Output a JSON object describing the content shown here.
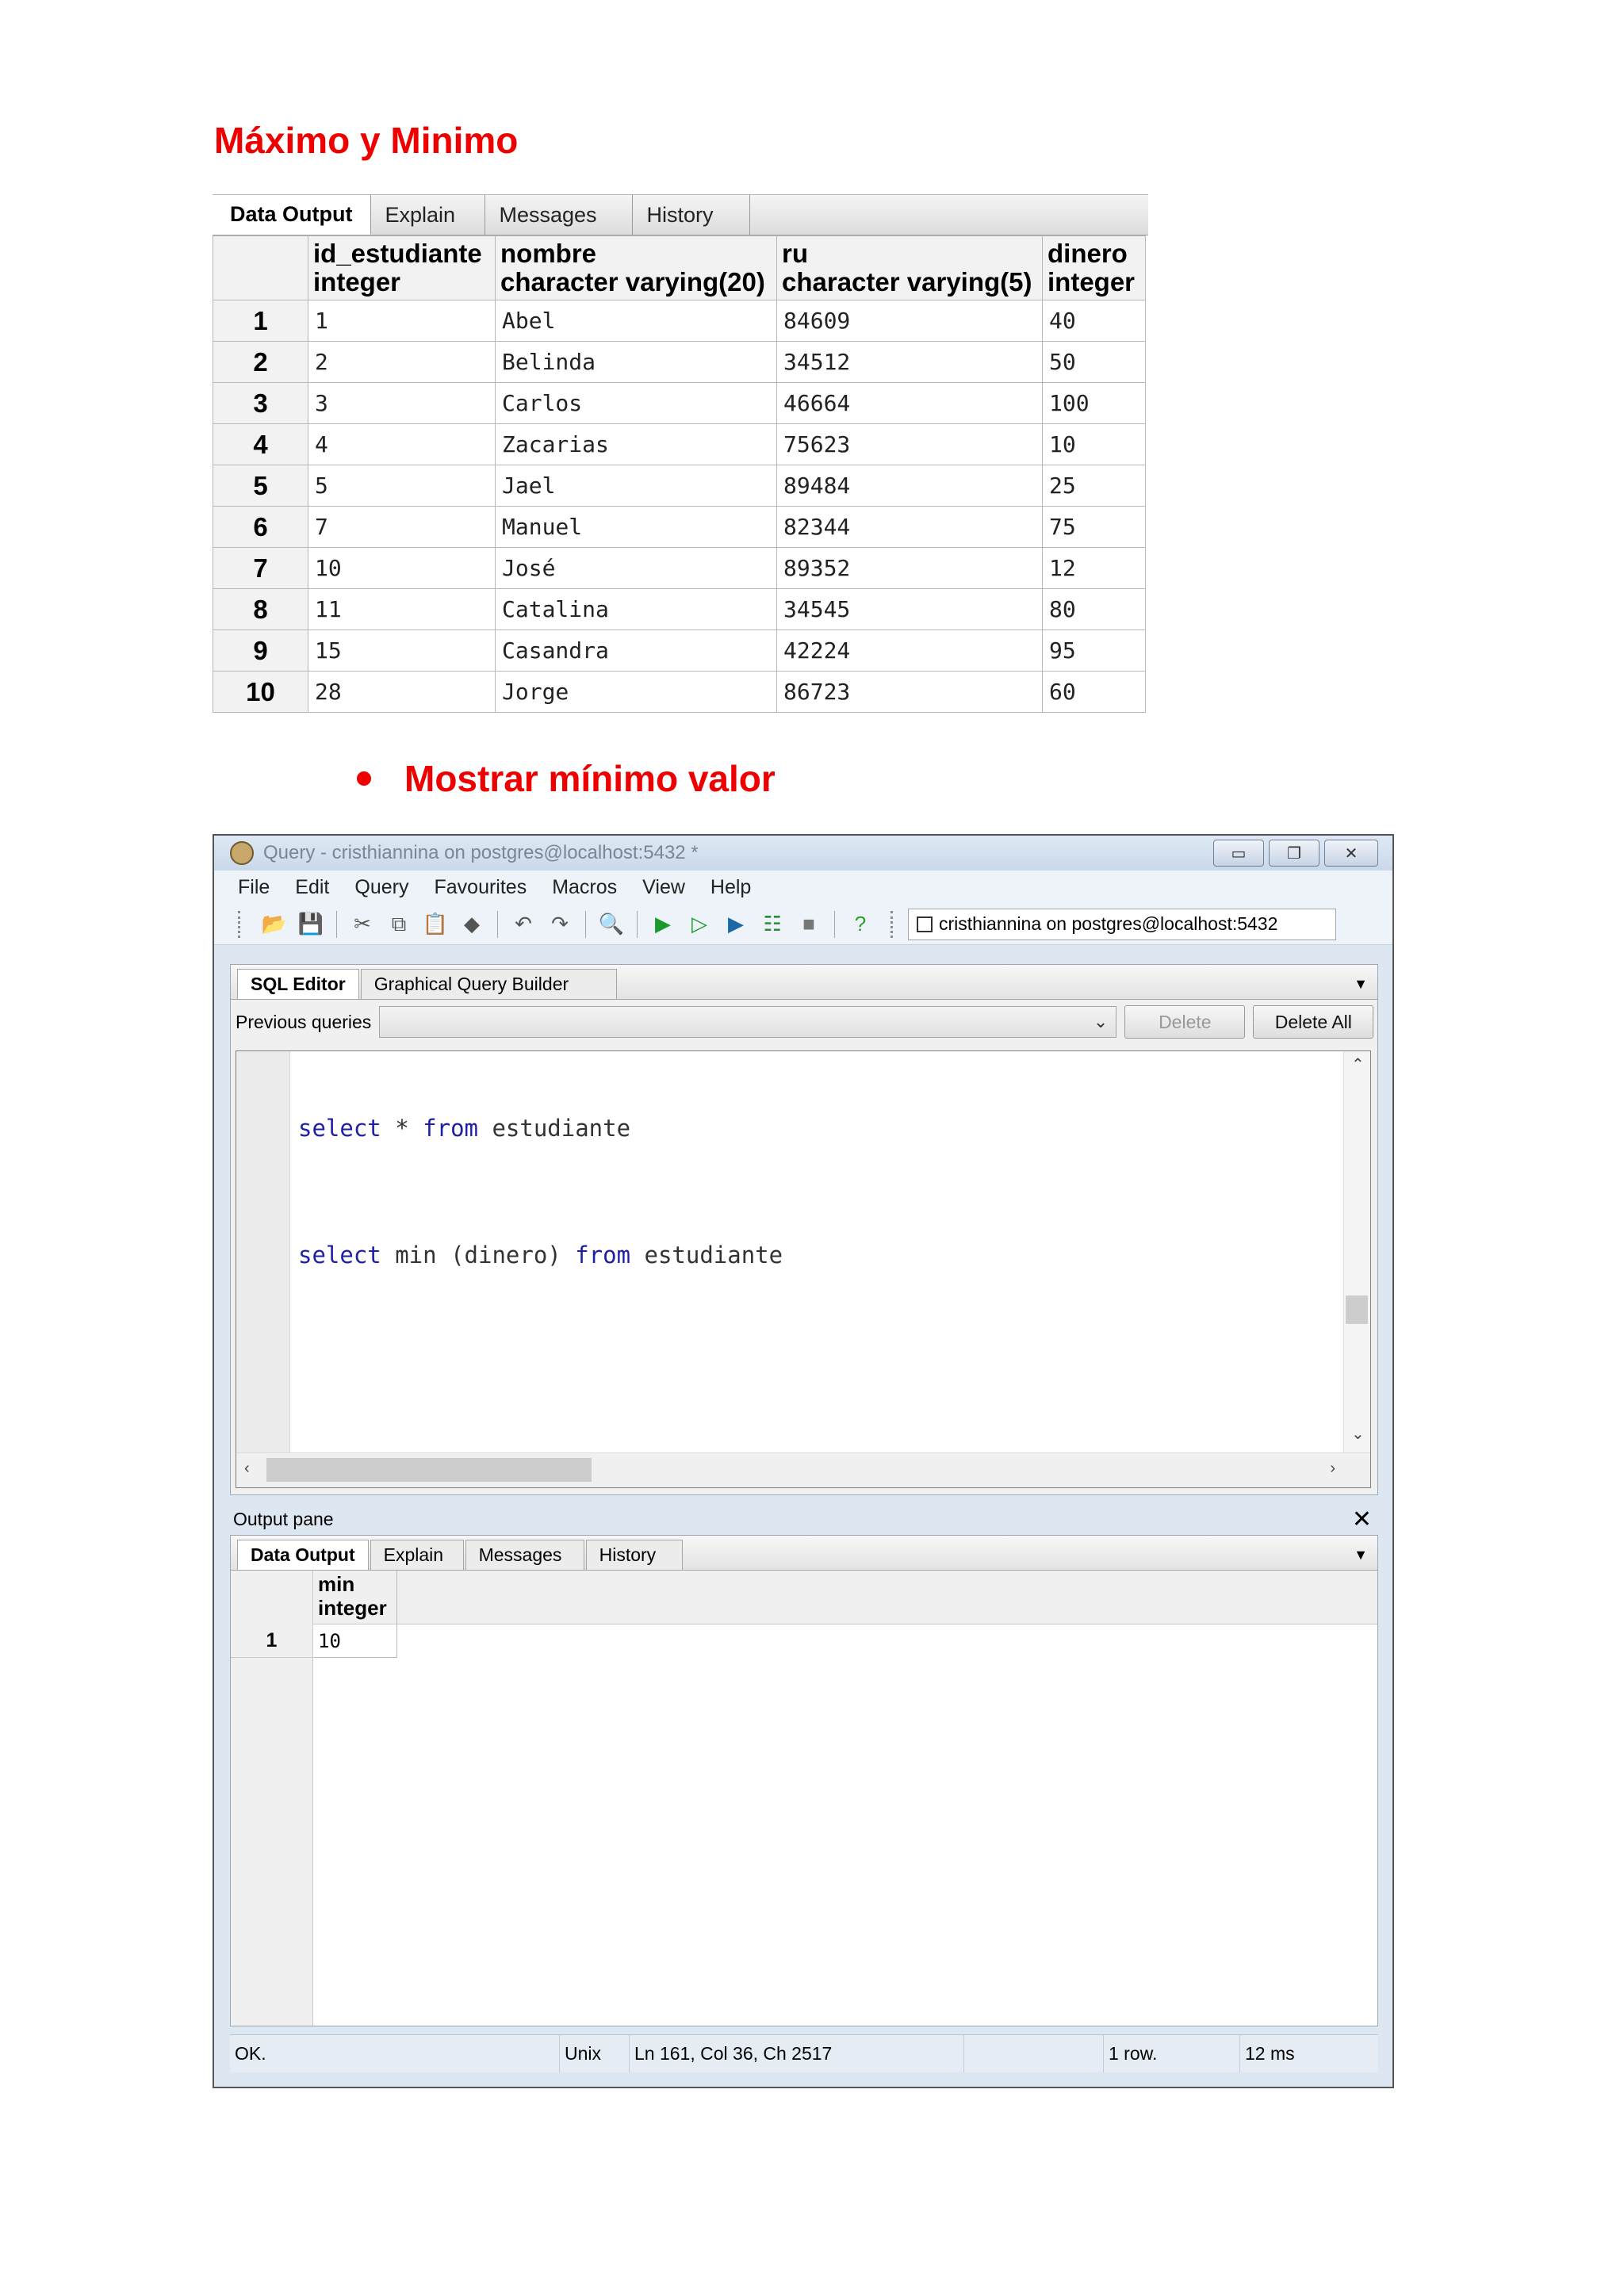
{
  "heading": "Máximo y Minimo",
  "bullet_text": "Mostrar mínimo valor",
  "grid1": {
    "tabs": [
      "Data Output",
      "Explain",
      "Messages",
      "History"
    ],
    "columns": [
      {
        "name": "id_estudiante",
        "type": "integer"
      },
      {
        "name": "nombre",
        "type": "character varying(20)"
      },
      {
        "name": "ru",
        "type": "character varying(5)"
      },
      {
        "name": "dinero",
        "type": "integer"
      }
    ],
    "rows": [
      [
        "1",
        "1",
        "Abel",
        "84609",
        "40"
      ],
      [
        "2",
        "2",
        "Belinda",
        "34512",
        "50"
      ],
      [
        "3",
        "3",
        "Carlos",
        "46664",
        "100"
      ],
      [
        "4",
        "4",
        "Zacarias",
        "75623",
        "10"
      ],
      [
        "5",
        "5",
        "Jael",
        "89484",
        "25"
      ],
      [
        "6",
        "7",
        "Manuel",
        "82344",
        "75"
      ],
      [
        "7",
        "10",
        "José",
        "89352",
        "12"
      ],
      [
        "8",
        "11",
        "Catalina",
        "34545",
        "80"
      ],
      [
        "9",
        "15",
        "Casandra",
        "42224",
        "95"
      ],
      [
        "10",
        "28",
        "Jorge",
        "86723",
        "60"
      ]
    ]
  },
  "window": {
    "title": "Query - cristhiannina on postgres@localhost:5432 *",
    "menu": [
      "File",
      "Edit",
      "Query",
      "Favourites",
      "Macros",
      "View",
      "Help"
    ],
    "connection": "cristhiannina on postgres@localhost:5432",
    "editor_tabs": [
      "SQL Editor",
      "Graphical Query Builder"
    ],
    "previous_queries_label": "Previous queries",
    "delete_label": "Delete",
    "delete_all_label": "Delete All",
    "code": {
      "line1_kw1": "select",
      "line1_rest1": " * ",
      "line1_kw2": "from",
      "line1_rest2": " estudiante",
      "line2_kw1": "select",
      "line2_rest1": " min (dinero) ",
      "line2_kw2": "from",
      "line2_rest2": " estudiante"
    },
    "output_pane_label": "Output pane",
    "output_tabs": [
      "Data Output",
      "Explain",
      "Messages",
      "History"
    ],
    "result": {
      "col_name": "min",
      "col_type": "integer",
      "row_num": "1",
      "value": "10"
    },
    "status": {
      "state": "OK.",
      "eol": "Unix",
      "position": "Ln 161, Col 36, Ch 2517",
      "rows": "1 row.",
      "time": "12 ms"
    }
  }
}
